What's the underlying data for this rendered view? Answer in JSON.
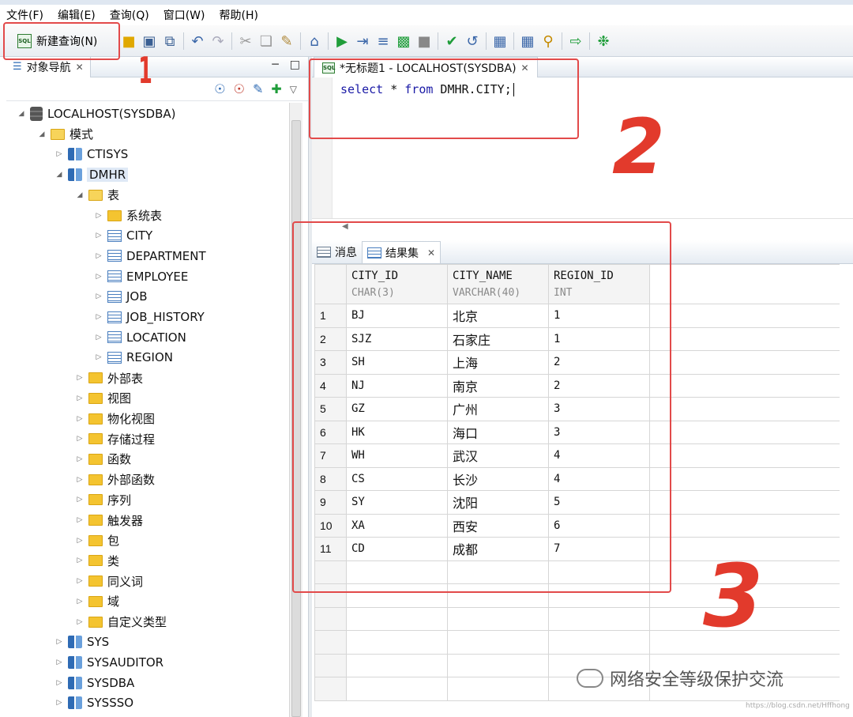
{
  "menu": [
    "文件(F)",
    "编辑(E)",
    "查询(Q)",
    "窗口(W)",
    "帮助(H)"
  ],
  "toolbar": {
    "new_query_label": "新建查询(N)",
    "sql_badge": "SQL"
  },
  "navigator": {
    "tab_label": "对象导航",
    "tree": [
      {
        "label": "LOCALHOST(SYSDBA)",
        "kind": "db",
        "level": 0,
        "expanded": true
      },
      {
        "label": "模式",
        "kind": "folder",
        "level": 1,
        "expanded": true
      },
      {
        "label": "CTISYS",
        "kind": "schema",
        "level": 2,
        "expanded": false
      },
      {
        "label": "DMHR",
        "kind": "schema",
        "level": 2,
        "expanded": true,
        "selected": true
      },
      {
        "label": "表",
        "kind": "folder",
        "level": 3,
        "expanded": true
      },
      {
        "label": "系统表",
        "kind": "folder",
        "level": 4,
        "expanded": false
      },
      {
        "label": "CITY",
        "kind": "table",
        "level": 4,
        "expanded": false
      },
      {
        "label": "DEPARTMENT",
        "kind": "table",
        "level": 4,
        "expanded": false
      },
      {
        "label": "EMPLOYEE",
        "kind": "table",
        "level": 4,
        "expanded": false
      },
      {
        "label": "JOB",
        "kind": "table",
        "level": 4,
        "expanded": false
      },
      {
        "label": "JOB_HISTORY",
        "kind": "table",
        "level": 4,
        "expanded": false
      },
      {
        "label": "LOCATION",
        "kind": "table",
        "level": 4,
        "expanded": false
      },
      {
        "label": "REGION",
        "kind": "table",
        "level": 4,
        "expanded": false
      },
      {
        "label": "外部表",
        "kind": "folder",
        "level": 3,
        "expanded": false
      },
      {
        "label": "视图",
        "kind": "folder",
        "level": 3,
        "expanded": false
      },
      {
        "label": "物化视图",
        "kind": "folder",
        "level": 3,
        "expanded": false
      },
      {
        "label": "存储过程",
        "kind": "folder",
        "level": 3,
        "expanded": false
      },
      {
        "label": "函数",
        "kind": "folder",
        "level": 3,
        "expanded": false
      },
      {
        "label": "外部函数",
        "kind": "folder",
        "level": 3,
        "expanded": false
      },
      {
        "label": "序列",
        "kind": "folder",
        "level": 3,
        "expanded": false
      },
      {
        "label": "触发器",
        "kind": "folder",
        "level": 3,
        "expanded": false
      },
      {
        "label": "包",
        "kind": "folder",
        "level": 3,
        "expanded": false
      },
      {
        "label": "类",
        "kind": "folder",
        "level": 3,
        "expanded": false
      },
      {
        "label": "同义词",
        "kind": "folder",
        "level": 3,
        "expanded": false
      },
      {
        "label": "域",
        "kind": "folder",
        "level": 3,
        "expanded": false
      },
      {
        "label": "自定义类型",
        "kind": "folder",
        "level": 3,
        "expanded": false
      },
      {
        "label": "SYS",
        "kind": "schema",
        "level": 2,
        "expanded": false
      },
      {
        "label": "SYSAUDITOR",
        "kind": "schema",
        "level": 2,
        "expanded": false
      },
      {
        "label": "SYSDBA",
        "kind": "schema",
        "level": 2,
        "expanded": false
      },
      {
        "label": "SYSSSO",
        "kind": "schema",
        "level": 2,
        "expanded": false
      }
    ]
  },
  "editor": {
    "tab_label": "*无标题1 - LOCALHOST(SYSDBA)",
    "sql_keyword1": "select",
    "sql_mid": " * ",
    "sql_keyword2": "from",
    "sql_rest": " DMHR.CITY;"
  },
  "results": {
    "tab_messages": "消息",
    "tab_resultset": "结果集",
    "columns": [
      {
        "name": "CITY_ID",
        "type": "CHAR(3)"
      },
      {
        "name": "CITY_NAME",
        "type": "VARCHAR(40)"
      },
      {
        "name": "REGION_ID",
        "type": "INT"
      }
    ],
    "rows": [
      [
        "1",
        "BJ",
        "北京",
        "1"
      ],
      [
        "2",
        "SJZ",
        "石家庄",
        "1"
      ],
      [
        "3",
        "SH",
        "上海",
        "2"
      ],
      [
        "4",
        "NJ",
        "南京",
        "2"
      ],
      [
        "5",
        "GZ",
        "广州",
        "3"
      ],
      [
        "6",
        "HK",
        "海口",
        "3"
      ],
      [
        "7",
        "WH",
        "武汉",
        "4"
      ],
      [
        "8",
        "CS",
        "长沙",
        "4"
      ],
      [
        "9",
        "SY",
        "沈阳",
        "5"
      ],
      [
        "10",
        "XA",
        "西安",
        "6"
      ],
      [
        "11",
        "CD",
        "成都",
        "7"
      ]
    ]
  },
  "annotations": [
    "1",
    "2",
    "3"
  ],
  "watermark": {
    "text": "网络安全等级保护交流",
    "url": "https://blog.csdn.net/Hffhong"
  },
  "colors": {
    "annotation_red": "#e24a4a",
    "keyword_blue": "#1a1aa6"
  }
}
